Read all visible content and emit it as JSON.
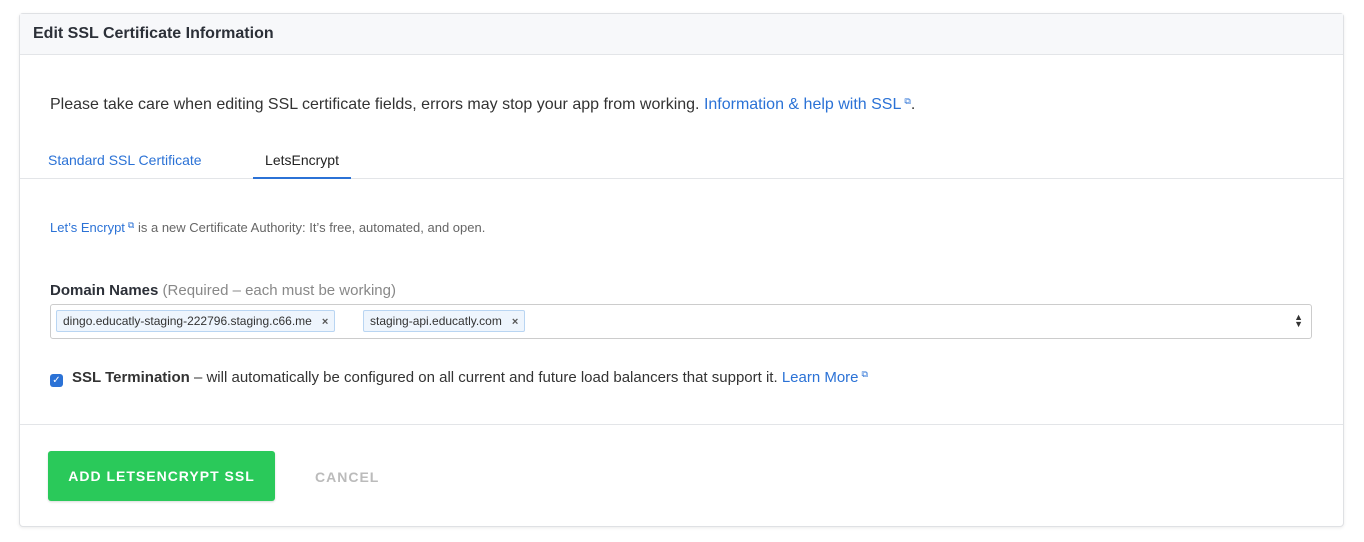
{
  "header": {
    "title": "Edit SSL Certificate Information"
  },
  "warning": {
    "text": "Please take care when editing SSL certificate fields, errors may stop your app from working. ",
    "link": "Information & help with SSL",
    "end": "."
  },
  "tabs": [
    {
      "label": "Standard SSL Certificate"
    },
    {
      "label": "LetsEncrypt",
      "active": true
    }
  ],
  "letsencrypt": {
    "link": "Let’s Encrypt",
    "text": " is a new Certificate Authority: It’s free, automated, and open."
  },
  "domains": {
    "label": "Domain Names",
    "hint": "(Required – each must be working)",
    "values": [
      "dingo.educatly-staging-222796.staging.c66.me",
      "staging-api.educatly.com"
    ],
    "remove": "×"
  },
  "termination": {
    "checked": true,
    "label": "SSL Termination",
    "text": " – will automatically be configured on all current and future load balancers that support it. ",
    "link": "Learn More"
  },
  "buttons": {
    "submit": "ADD LETSENCRYPT SSL",
    "cancel": "CANCEL"
  },
  "colors": {
    "accent": "#2b72d6",
    "success": "#2ac95a"
  }
}
